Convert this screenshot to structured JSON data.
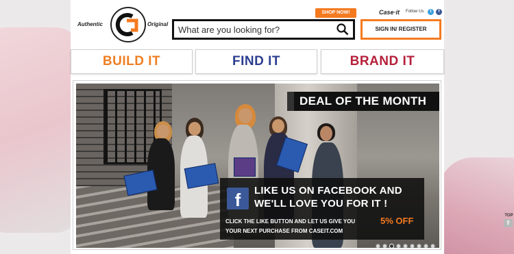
{
  "header": {
    "tagline_left": "Authentic",
    "tagline_right": "Original",
    "shop_now": "SHOP NOW!",
    "brand_mini": "Case·it",
    "follow_us": "Follow Us",
    "social": [
      "twitter-icon",
      "facebook-icon"
    ],
    "search": {
      "placeholder": "What are you looking for?"
    },
    "signin": "SIGN IN/ REGISTER"
  },
  "nav": {
    "build": "BUILD IT",
    "find": "FIND IT",
    "brand": "BRAND IT"
  },
  "hero": {
    "deal": "DEAL OF THE MONTH",
    "promo_line1": "LIKE US ON FACEBOOK AND",
    "promo_line2": "WE'LL LOVE YOU FOR IT !",
    "sub1": "CLICK THE LIKE BUTTON AND LET US GIVE YOU",
    "percent": "5% OFF",
    "sub2": "YOUR NEXT PURCHASE FROM CASEIT.COM",
    "slide_count": 10,
    "active_slide": 3
  },
  "top_label": "TOP",
  "colors": {
    "accent_orange": "#f47a20",
    "find_blue": "#2c3d8f",
    "brand_red": "#b51f3a",
    "facebook": "#3b5998"
  }
}
